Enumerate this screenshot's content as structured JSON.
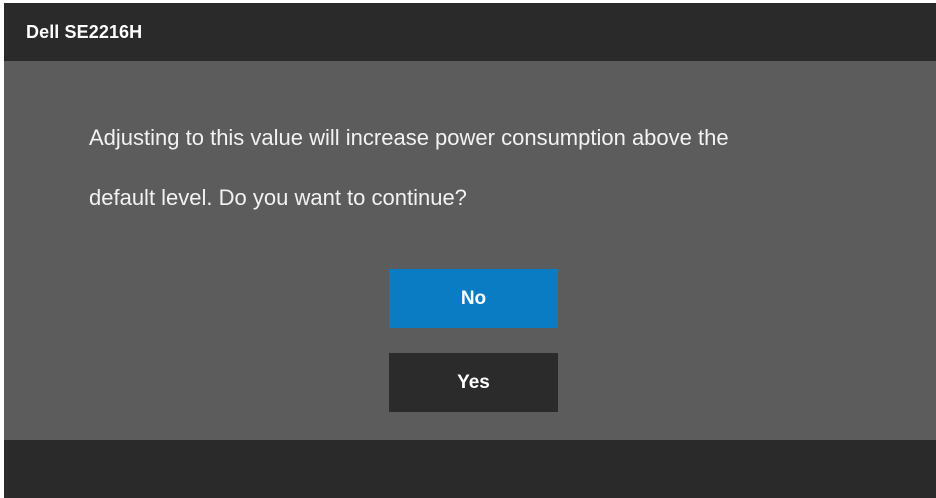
{
  "window": {
    "title": "Dell SE2216H"
  },
  "dialog": {
    "message_line1": "Adjusting to this value will increase power consumption above the",
    "message_line2": "default level. Do you want to continue?"
  },
  "buttons": {
    "no_label": "No",
    "yes_label": "Yes"
  },
  "colors": {
    "title_bar": "#2a2a2a",
    "body": "#5c5c5c",
    "selected_button": "#0a7cc3",
    "unselected_button": "#2b2b2b",
    "text": "#ffffff"
  }
}
